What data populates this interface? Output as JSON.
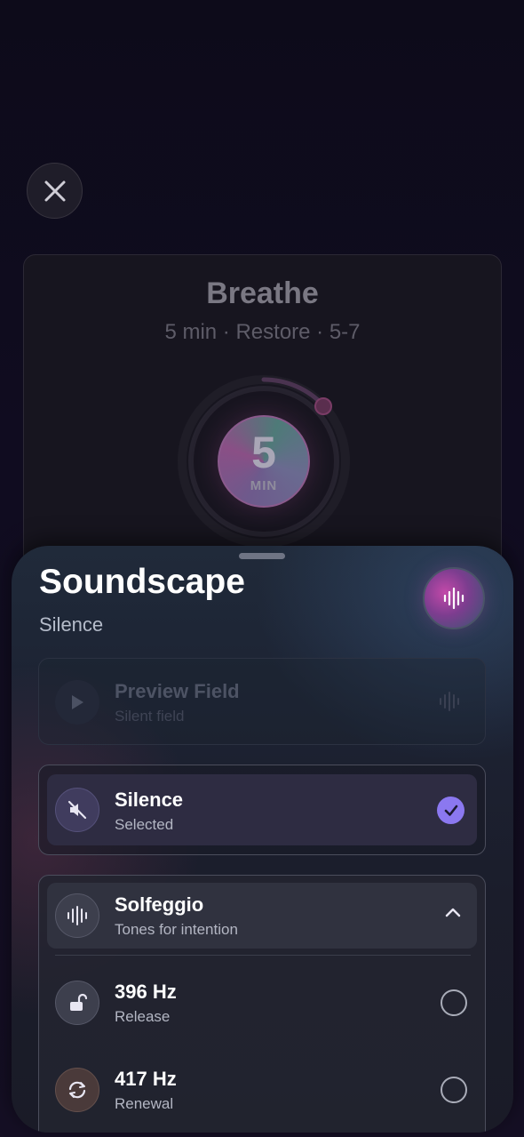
{
  "close": {
    "icon": "close-icon"
  },
  "background_card": {
    "title": "Breathe",
    "subtitle": "5 min · Restore · 5-7",
    "dial": {
      "value": "5",
      "unit": "MIN"
    }
  },
  "sheet": {
    "title": "Soundscape",
    "subtitle": "Silence",
    "orb_icon": "waveform-icon",
    "preview": {
      "title": "Preview Field",
      "subtitle": "Silent field",
      "play_icon": "play-icon"
    },
    "silence_option": {
      "title": "Silence",
      "subtitle": "Selected",
      "icon": "mute-icon",
      "selected": true
    },
    "solfeggio": {
      "title": "Solfeggio",
      "subtitle": "Tones for intention",
      "icon": "waveform-icon",
      "expanded": true,
      "items": [
        {
          "title": "396 Hz",
          "subtitle": "Release",
          "icon": "unlock-icon",
          "selected": false
        },
        {
          "title": "417 Hz",
          "subtitle": "Renewal",
          "icon": "refresh-icon",
          "selected": false
        }
      ]
    }
  },
  "colors": {
    "accent": "#8b78f0",
    "background": "#0d0b1a",
    "orb": "#c249a9"
  }
}
